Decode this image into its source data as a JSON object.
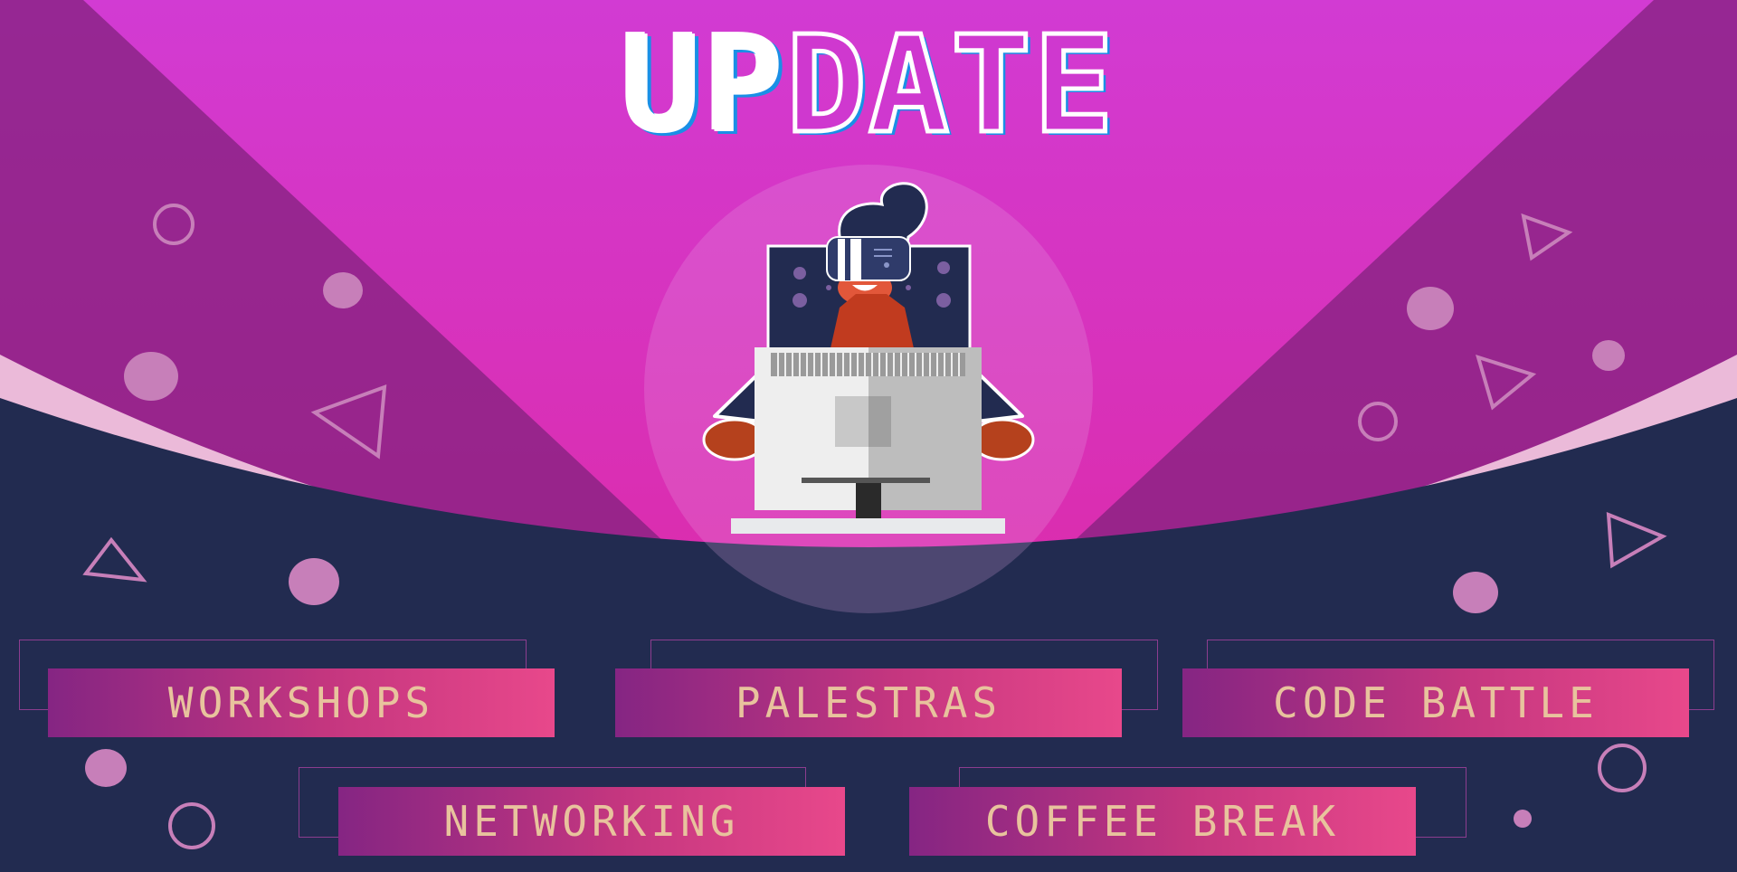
{
  "header": {
    "title_part1": "UP",
    "title_part2": "DATE"
  },
  "buttons": [
    "WORKSHOPS",
    "PALESTRAS",
    "CODE BATTLE",
    "NETWORKING",
    "COFFEE BREAK"
  ],
  "colors": {
    "sky_top": "#d23bd3",
    "sky_bottom": "#e0259a",
    "navy": "#222b50",
    "band": "#ebbad9",
    "shape": "#c77fb9",
    "button_start": "#852583",
    "button_end": "#e8488b",
    "button_text": "#e8c39d",
    "title_shadow": "#1a8fe6"
  },
  "illustration": {
    "subject": "person-wearing-vr-headset-behind-monitor"
  }
}
